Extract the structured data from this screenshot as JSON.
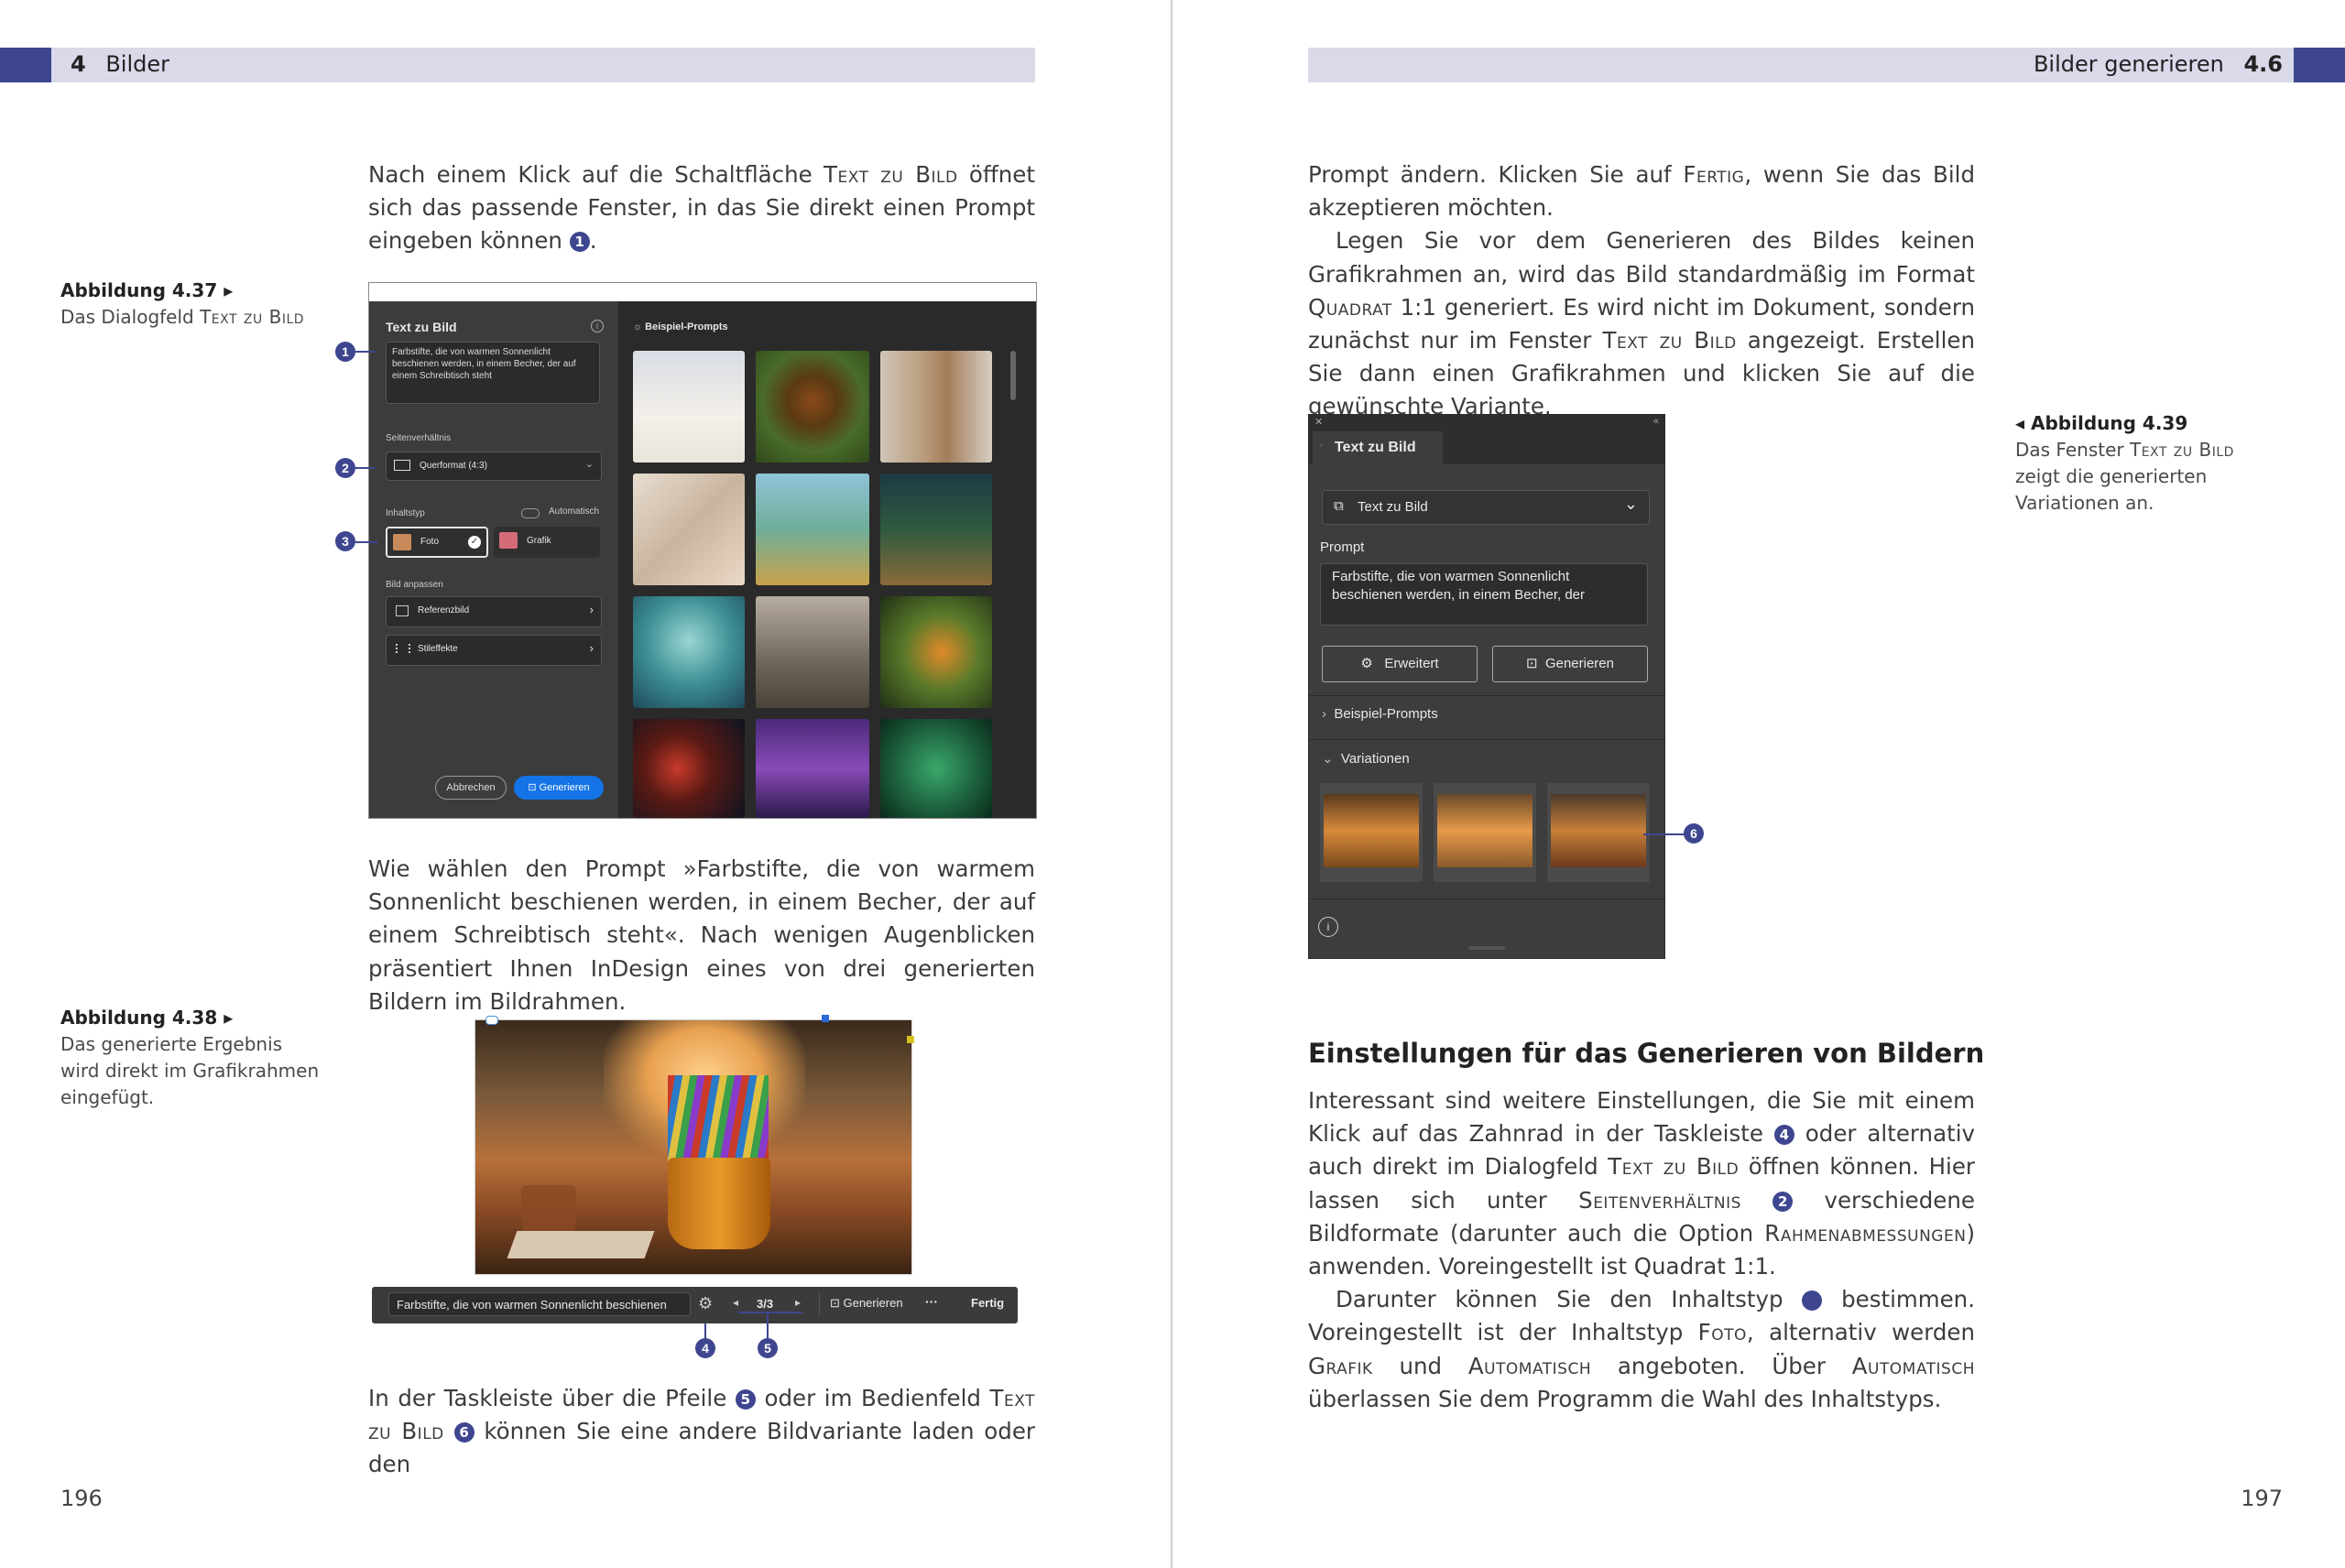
{
  "left_page": {
    "header": {
      "chapter_number": "4",
      "chapter_title": "Bilder"
    },
    "para1": {
      "t1": "Nach einem Klick auf die Schaltfläche ",
      "sc1": "Text zu Bild",
      "t2": " öffnet sich das passende Fenster, in das Sie direkt einen Prompt eingeben können ",
      "marker": "1",
      "t3": "."
    },
    "figure_437": {
      "caption_title": "Abbildung 4.37 ▸",
      "caption_t1": "Das Dialogfeld ",
      "caption_sc": "Text zu Bild",
      "dialog": {
        "title": "Text zu Bild",
        "prompt_text": "Farbstifte, die von warmen Sonnenlicht beschienen werden, in einem Becher, der auf einem Schreibtisch steht",
        "aspect_label": "Seitenverhältnis",
        "aspect_value": "Querformat (4:3)",
        "content_label": "Inhaltstyp",
        "auto_label": "Automatisch",
        "foto_label": "Foto",
        "grafik_label": "Grafik",
        "adjust_label": "Bild anpassen",
        "ref_label": "Referenzbild",
        "style_label": "Stileffekte",
        "cancel_label": "Abbrechen",
        "generate_label": "Generieren",
        "examples_title": "Beispiel-Prompts"
      },
      "callouts": [
        "1",
        "2",
        "3"
      ]
    },
    "para2": "Wie wählen den Prompt »Farbstifte, die von warmem Sonnenlicht beschienen werden, in einem Becher, der auf einem Schreibtisch steht«. Nach wenigen Augenblicken präsentiert Ihnen InDesign eines von drei generierten Bildern im Bildrahmen.",
    "figure_438": {
      "caption_title": "Abbildung 4.38 ▸",
      "caption_text": "Das generierte Ergebnis wird direkt im Grafikrahmen eingefügt.",
      "taskbar": {
        "prompt": "Farbstifte, die von warmen Sonnenlicht beschienen",
        "counter": "3/3",
        "generate_label": "Generieren",
        "more_label": "···",
        "done_label": "Fertig"
      },
      "callouts": [
        "4",
        "5"
      ]
    },
    "para3": {
      "t1": "In der Taskleiste über die Pfeile ",
      "m1": "5",
      "t2": " oder im Bedienfeld ",
      "sc1": "Text zu Bild",
      "m2": "6",
      "t3": " können Sie eine andere Bildvariante laden oder den"
    },
    "page_number": "196"
  },
  "right_page": {
    "header": {
      "section_title": "Bilder generieren",
      "section_number": "4.6"
    },
    "para1": {
      "t1": "Prompt ändern. Klicken Sie auf ",
      "sc1": "Fertig",
      "t2": ", wenn Sie das Bild akzeptieren möchten."
    },
    "para2": {
      "t1": "Legen Sie vor dem Generieren des Bildes keinen Grafikrahmen an, wird das Bild standardmäßig im Format ",
      "sc1": "Quadrat",
      "t2": " 1:1 generiert. Es wird nicht im Dokument, sondern zunächst nur im Fenster ",
      "sc2": "Text zu Bild",
      "t3": " angezeigt. Erstellen Sie dann einen Grafikrahmen und klicken Sie auf die gewünschte Variante."
    },
    "figure_439": {
      "caption_title": "◂ Abbildung 4.39",
      "caption_t1": "Das Fenster ",
      "caption_sc": "Text zu Bild",
      "caption_t2": " zeigt die generierten Variationen an.",
      "panel": {
        "tab_title": "Text zu Bild",
        "mode_value": "Text zu Bild",
        "prompt_label": "Prompt",
        "prompt_text": "Farbstifte, die von warmen Sonnenlicht beschienen werden, in einem Becher, der",
        "advanced_label": "Erweitert",
        "generate_label": "Generieren",
        "examples_label": "Beispiel-Prompts",
        "variations_label": "Variationen"
      },
      "callout": "6"
    },
    "heading": "Einstellungen für das Generieren von Bildern",
    "para3": {
      "t1": "Interessant sind weitere Einstellungen, die Sie mit einem Klick auf das Zahnrad in der Taskleiste ",
      "m1": "4",
      "t2": " oder alternativ auch direkt im Dialogfeld ",
      "sc1": "Text zu Bild",
      "t3": " öffnen können. Hier lassen sich unter ",
      "sc2": "Seitenverhältnis",
      "m2": "2",
      "t4": " verschiedene Bildformate (darunter auch die Option ",
      "sc3": "Rahmenabmessungen",
      "t5": ") anwenden. Voreingestellt ist Quadrat 1:1."
    },
    "para4": {
      "t1": "Darunter können Sie den Inhaltstyp ",
      "m1": "3",
      "t2": " bestimmen. Voreingestellt ist der Inhaltstyp ",
      "sc1": "Foto",
      "t3": ", alternativ werden ",
      "sc2": "Grafik",
      "t4": " und ",
      "sc3": "Automatisch",
      "t5": " angeboten. Über ",
      "sc4": "Automatisch",
      "t6": " überlassen Sie dem Programm die Wahl des Inhaltstyps."
    },
    "page_number": "197"
  },
  "colors": {
    "accent": "#3e4690",
    "header_bar": "#d9d9ea",
    "generate_blue": "#1473e6"
  }
}
